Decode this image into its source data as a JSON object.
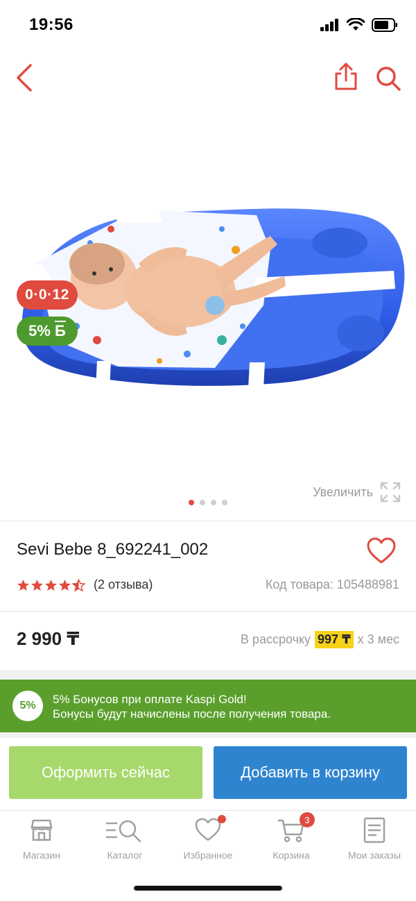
{
  "status_bar": {
    "time": "19:56"
  },
  "product": {
    "badge_installment": "0·0·12",
    "badge_bonus": "5%",
    "badge_bonus_mark": "Б",
    "zoom_label": "Увеличить",
    "gallery_dots": 4,
    "gallery_active_index": 0,
    "title": "Sevi Bebe 8_692241_002",
    "rating": 4.5,
    "reviews": "(2 отзыва)",
    "sku": "Код товара: 105488981",
    "price": "2 990 ₸",
    "installment_prefix": "В рассрочку",
    "installment_amount": "997 ₸",
    "installment_suffix": "х 3 мес"
  },
  "bonus_banner": {
    "circle": "5%",
    "line1": "5% Бонусов при оплате Kaspi Gold!",
    "line2": "Бонусы будут начислены после получения товара."
  },
  "actions": {
    "buy_now": "Оформить сейчас",
    "add_to_cart": "Добавить в корзину"
  },
  "tabs": [
    {
      "label": "Магазин",
      "icon": "store-icon"
    },
    {
      "label": "Каталог",
      "icon": "catalog-icon"
    },
    {
      "label": "Избранное",
      "icon": "heart-icon"
    },
    {
      "label": "Корзина",
      "icon": "cart-icon",
      "badge": "3"
    },
    {
      "label": "Мои заказы",
      "icon": "orders-icon"
    }
  ],
  "colors": {
    "accent_red": "#e04a3f",
    "kaspi_green": "#5a9f2c",
    "buy_button": "#a6d86b",
    "cart_button": "#2f84cf",
    "installment_highlight": "#f7d21a"
  }
}
